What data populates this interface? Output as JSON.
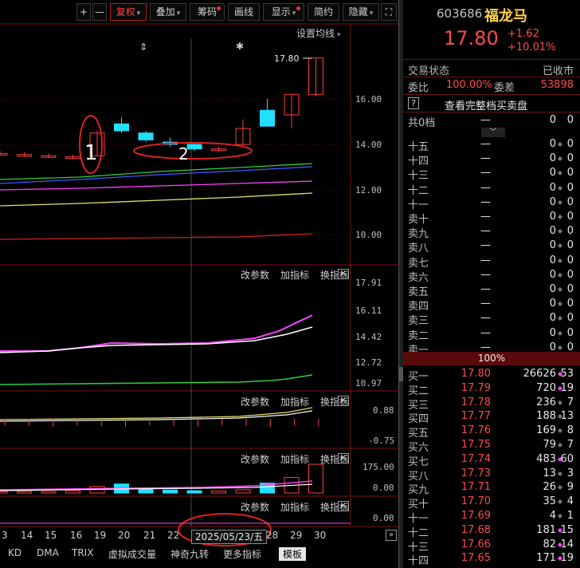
{
  "toolbar": {
    "plus": "+",
    "minus": "—",
    "fuquan": "复权",
    "diejia": "叠加",
    "chouma": "筹码",
    "huaxian": "画线",
    "xianshi": "显示",
    "jianyue": "简约",
    "yincang": "隐藏"
  },
  "chart": {
    "setting_link": "设置均线",
    "top_marker": "⇕",
    "star_marker": "✱",
    "high_label": "17.80",
    "annotation_1": "1",
    "annotation_2": "2",
    "price_axis": [
      "16.00",
      "14.00",
      "12.00",
      "10.00"
    ],
    "pane2_axis": [
      "17.91",
      "16.11",
      "14.42",
      "12.72",
      "10.97"
    ],
    "pane3_axis": [
      "0.88",
      "-0.75"
    ],
    "pane4_axis": [
      "175.00",
      "0.00"
    ],
    "pane5_axis": [
      "0.00"
    ],
    "pane_tools": [
      "改参数",
      "加指标",
      "换指标"
    ],
    "close_x": "✕",
    "dates": [
      "3",
      "14",
      "15",
      "16",
      "19",
      "20",
      "21",
      "22",
      "28",
      "29",
      "30"
    ],
    "date_box": "2025/05/23/五",
    "scroll_arrow": "»",
    "indicator_tabs": [
      "KD",
      "DMA",
      "TRIX",
      "虚拟成交量",
      "神奇九转",
      "更多指标",
      "模板"
    ],
    "colors": {
      "up": "#ff3c3c",
      "down": "#22e0ff",
      "ma_white": "#ffffff",
      "ma_yellow": "#e8e070",
      "ma_magenta": "#ff40ff",
      "ma_green": "#2ecc40",
      "ma_blue": "#3a5cff"
    }
  },
  "chart_data": {
    "type": "candlestick",
    "ylim": [
      9.5,
      18.2
    ],
    "candles": [
      {
        "o": 13.6,
        "c": 13.6,
        "h": 13.7,
        "l": 13.5
      },
      {
        "o": 13.55,
        "c": 13.55,
        "h": 13.65,
        "l": 13.45
      },
      {
        "o": 13.5,
        "c": 13.5,
        "h": 13.6,
        "l": 13.4
      },
      {
        "o": 13.45,
        "c": 13.45,
        "h": 13.55,
        "l": 13.35
      },
      {
        "o": 13.5,
        "c": 14.5,
        "h": 14.6,
        "l": 13.5
      },
      {
        "o": 14.9,
        "c": 14.6,
        "h": 15.2,
        "l": 14.5
      },
      {
        "o": 14.5,
        "c": 14.2,
        "h": 14.6,
        "l": 14.1
      },
      {
        "o": 14.1,
        "c": 14.0,
        "h": 14.3,
        "l": 13.9
      },
      {
        "o": 14.0,
        "c": 13.8,
        "h": 14.1,
        "l": 13.7
      },
      {
        "o": 13.8,
        "c": 13.8,
        "h": 13.9,
        "l": 13.7
      },
      {
        "o": 14.0,
        "c": 14.7,
        "h": 15.1,
        "l": 13.95
      },
      {
        "o": 15.5,
        "c": 14.8,
        "h": 16.0,
        "l": 14.8
      },
      {
        "o": 15.3,
        "c": 16.2,
        "h": 16.2,
        "l": 14.7
      },
      {
        "o": 16.2,
        "c": 17.8,
        "h": 17.8,
        "l": 16.1
      }
    ],
    "volume": [
      10,
      8,
      9,
      15,
      40,
      55,
      30,
      18,
      14,
      12,
      20,
      60,
      95,
      175
    ]
  },
  "panel": {
    "code": "603686",
    "name": "福龙马",
    "price": "17.80",
    "change": "+1.62",
    "change_pct": "+10.01%",
    "trade_status_label": "交易状态",
    "trade_status_value": "已收市",
    "weibi_label": "委比",
    "weibi_value": "100.00%",
    "weicha_label": "委差",
    "weicha_value": "53898",
    "help": "?",
    "full_book": "查看完整档买卖盘",
    "gong_label": "共0档",
    "dash": "—",
    "zero": "0",
    "pct_bar": "100%",
    "sell_rows": [
      {
        "label": "十五",
        "price": "—",
        "vol": "0",
        "cnt": "0"
      },
      {
        "label": "十四",
        "price": "—",
        "vol": "0",
        "cnt": "0"
      },
      {
        "label": "十三",
        "price": "—",
        "vol": "0",
        "cnt": "0"
      },
      {
        "label": "十二",
        "price": "—",
        "vol": "0",
        "cnt": "0"
      },
      {
        "label": "十一",
        "price": "—",
        "vol": "0",
        "cnt": "0"
      },
      {
        "label": "卖十",
        "price": "—",
        "vol": "0",
        "cnt": "0"
      },
      {
        "label": "卖九",
        "price": "—",
        "vol": "0",
        "cnt": "0"
      },
      {
        "label": "卖八",
        "price": "—",
        "vol": "0",
        "cnt": "0"
      },
      {
        "label": "卖七",
        "price": "—",
        "vol": "0",
        "cnt": "0"
      },
      {
        "label": "卖六",
        "price": "—",
        "vol": "0",
        "cnt": "0"
      },
      {
        "label": "卖五",
        "price": "—",
        "vol": "0",
        "cnt": "0"
      },
      {
        "label": "卖四",
        "price": "—",
        "vol": "0",
        "cnt": "0"
      },
      {
        "label": "卖三",
        "price": "—",
        "vol": "0",
        "cnt": "0"
      },
      {
        "label": "卖二",
        "price": "—",
        "vol": "0",
        "cnt": "0"
      },
      {
        "label": "卖一",
        "price": "—",
        "vol": "0",
        "cnt": "0"
      }
    ],
    "buy_rows": [
      {
        "label": "买一",
        "price": "17.80",
        "vol": "26626",
        "cnt": "53",
        "dot": "magenta"
      },
      {
        "label": "买二",
        "price": "17.79",
        "vol": "720",
        "cnt": "19",
        "dot": "magenta"
      },
      {
        "label": "买三",
        "price": "17.78",
        "vol": "236",
        "cnt": "7",
        "dot": "gray"
      },
      {
        "label": "买四",
        "price": "17.77",
        "vol": "188",
        "cnt": "13",
        "dot": "gray"
      },
      {
        "label": "买五",
        "price": "17.76",
        "vol": "169",
        "cnt": "8",
        "dot": "gray"
      },
      {
        "label": "买六",
        "price": "17.75",
        "vol": "79",
        "cnt": "7",
        "dot": "gray"
      },
      {
        "label": "买七",
        "price": "17.74",
        "vol": "483",
        "cnt": "60",
        "dot": "magenta"
      },
      {
        "label": "买八",
        "price": "17.73",
        "vol": "13",
        "cnt": "3",
        "dot": "gray"
      },
      {
        "label": "买九",
        "price": "17.71",
        "vol": "26",
        "cnt": "9",
        "dot": "gray"
      },
      {
        "label": "买十",
        "price": "17.70",
        "vol": "35",
        "cnt": "4",
        "dot": "gray"
      },
      {
        "label": "十一",
        "price": "17.69",
        "vol": "4",
        "cnt": "1",
        "dot": "gray"
      },
      {
        "label": "十二",
        "price": "17.68",
        "vol": "181",
        "cnt": "15",
        "dot": "magenta"
      },
      {
        "label": "十三",
        "price": "17.66",
        "vol": "82",
        "cnt": "14",
        "dot": "magenta"
      },
      {
        "label": "十四",
        "price": "17.65",
        "vol": "171",
        "cnt": "19",
        "dot": "magenta"
      }
    ]
  }
}
